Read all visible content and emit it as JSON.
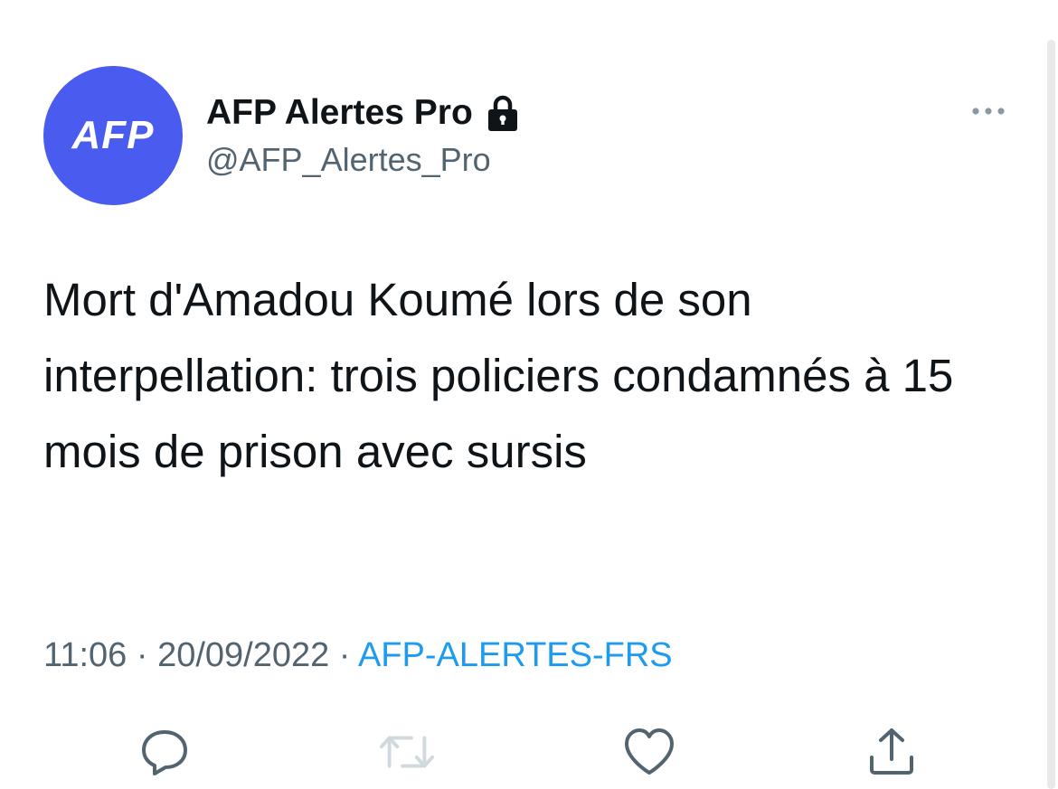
{
  "author": {
    "avatar_text": "AFP",
    "display_name": "AFP Alertes Pro",
    "handle": "@AFP_Alertes_Pro",
    "protected_icon": "lock-icon"
  },
  "tweet": {
    "text": "Mort d'Amadou Koumé lors de son interpellation: trois policiers condamnés à 15 mois de prison avec sursis"
  },
  "meta": {
    "time": "11:06",
    "separator_1": " · ",
    "date": "20/09/2022",
    "separator_2": " · ",
    "source": "AFP-ALERTES-FRS"
  },
  "icons": {
    "more": "more-icon",
    "reply": "reply-icon",
    "retweet": "retweet-icon",
    "like": "heart-icon",
    "share": "share-icon"
  },
  "colors": {
    "avatar_bg": "#4a5bf0",
    "text_primary": "#0f1419",
    "text_secondary": "#536471",
    "link": "#1d9bf0",
    "retweet_disabled": "#cfd9de"
  }
}
